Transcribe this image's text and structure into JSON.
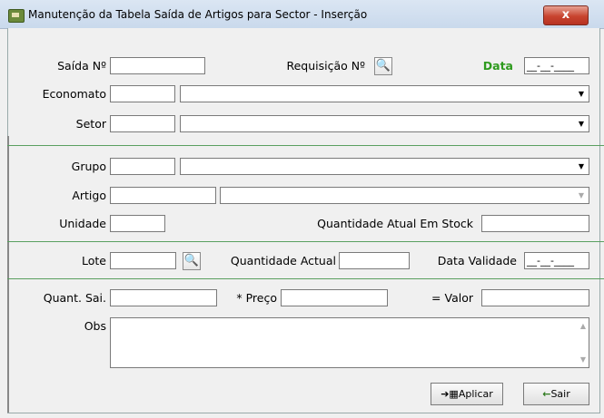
{
  "window": {
    "title": "Manutenção da Tabela Saída de Artigos para Sector - Inserção",
    "close_label": "x"
  },
  "header_section": {
    "saida_label": "Saída Nº",
    "requisicao_label": "Requisição Nº",
    "data_label": "Data",
    "data_value": "__-__-____",
    "economato_label": "Economato",
    "setor_label": "Setor"
  },
  "item_section": {
    "grupo_label": "Grupo",
    "artigo_label": "Artigo",
    "unidade_label": "Unidade",
    "stock_label": "Quantidade Atual Em Stock"
  },
  "lote_section": {
    "lote_label": "Lote",
    "qtd_actual_label": "Quantidade Actual",
    "validade_label": "Data Validade",
    "validade_value": "__-__-____"
  },
  "value_section": {
    "quant_label": "Quant. Sai.",
    "preco_label": "* Preço",
    "valor_label": "= Valor",
    "obs_label": "Obs"
  },
  "buttons": {
    "aplicar": "Aplicar",
    "sair": "Sair"
  },
  "icons": {
    "binoculars": "binoculars-icon",
    "combo_arrow": "▼",
    "scroll_up": "▲",
    "scroll_down": "▼"
  }
}
